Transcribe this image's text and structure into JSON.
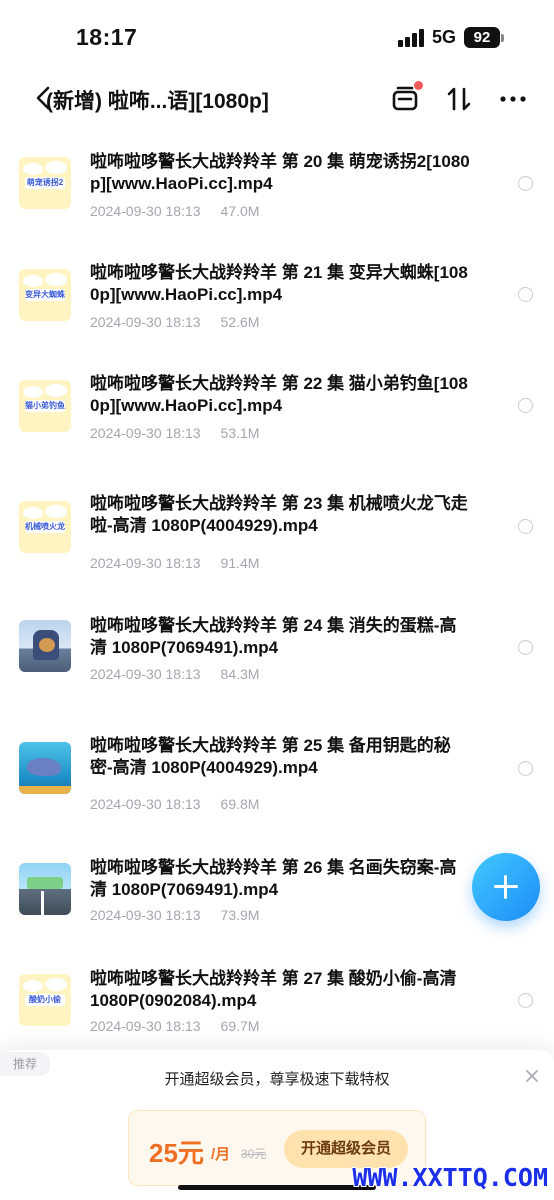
{
  "status_bar": {
    "time": "18:17",
    "network": "5G",
    "battery": "92"
  },
  "header": {
    "title": "(新增) 啦咘...语][1080p]",
    "icons": [
      "back-chevron-icon",
      "inbox-icon",
      "sort-icon",
      "more-icon"
    ],
    "notify_color": "#f25a5a"
  },
  "files": [
    {
      "name": "啦咘啦哆警长大战羚羚羊 第 20 集 萌宠诱拐2[1080p][www.HaoPi.cc].mp4",
      "date": "2024-09-30 18:13",
      "size": "47.0M",
      "thumb_label": "萌宠诱拐2",
      "thumb_style": "yellow"
    },
    {
      "name": "啦咘啦哆警长大战羚羚羊 第 21 集 变异大蜘蛛[1080p][www.HaoPi.cc].mp4",
      "date": "2024-09-30 18:13",
      "size": "52.6M",
      "thumb_label": "变异大蜘蛛",
      "thumb_style": "yellow"
    },
    {
      "name": "啦咘啦哆警长大战羚羚羊 第 22 集 猫小弟钓鱼[1080p][www.HaoPi.cc].mp4",
      "date": "2024-09-30 18:13",
      "size": "53.1M",
      "thumb_label": "猫小弟钓鱼",
      "thumb_style": "yellow"
    },
    {
      "name": "啦咘啦哆警长大战羚羚羊 第 23 集 机械喷火龙飞走啦-高清 1080P(4004929).mp4",
      "date": "2024-09-30 18:13",
      "size": "91.4M",
      "thumb_label": "机械喷火龙飞走啦",
      "thumb_style": "yellow"
    },
    {
      "name": "啦咘啦哆警长大战羚羚羊 第 24 集 消失的蛋糕-高清 1080P(7069491).mp4",
      "date": "2024-09-30 18:13",
      "size": "84.3M",
      "thumb_label": "",
      "thumb_style": "police"
    },
    {
      "name": "啦咘啦哆警长大战羚羚羊 第 25 集 备用钥匙的秘密-高清 1080P(4004929).mp4",
      "date": "2024-09-30 18:13",
      "size": "69.8M",
      "thumb_label": "",
      "thumb_style": "ocean"
    },
    {
      "name": "啦咘啦哆警长大战羚羚羊 第 26 集 名画失窃案-高清 1080P(7069491).mp4",
      "date": "2024-09-30 18:13",
      "size": "73.9M",
      "thumb_label": "",
      "thumb_style": "city"
    },
    {
      "name": "啦咘啦哆警长大战羚羚羊 第 27 集 酸奶小偷-高清 1080P(0902084).mp4",
      "date": "2024-09-30 18:13",
      "size": "69.7M",
      "thumb_label": "酸奶小偷",
      "thumb_style": "yellow"
    }
  ],
  "fab": {
    "icon": "plus-icon",
    "color": "#1e8cf7"
  },
  "promo": {
    "tag": "推荐",
    "text": "开通超级会员，尊享极速下载特权",
    "price": "25元",
    "unit": "/月",
    "old_price": "30元",
    "button": "开通超级会员",
    "accent": "#ef6f22"
  },
  "watermark": "WWW.XXTTQ.COM"
}
